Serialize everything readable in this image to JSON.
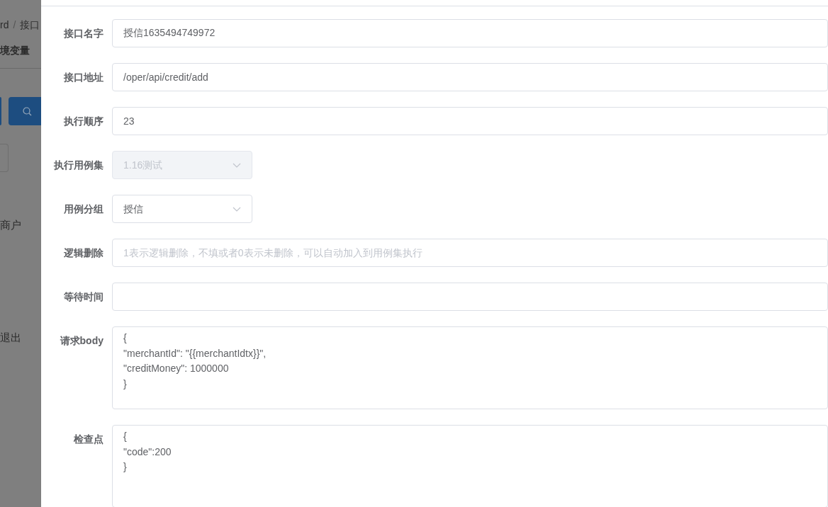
{
  "background": {
    "breadcrumb": [
      "rd",
      "/",
      "接口"
    ],
    "tab": "境变量",
    "menu_items": [
      "商户",
      "退出"
    ]
  },
  "form": {
    "fields": [
      {
        "label": "接口名字",
        "kind": "text",
        "value": "授信1635494749972",
        "disabled": false
      },
      {
        "label": "接口地址",
        "kind": "text",
        "value": "/oper/api/credit/add",
        "disabled": false
      },
      {
        "label": "执行顺序",
        "kind": "text",
        "value": "23",
        "disabled": false
      },
      {
        "label": "执行用例集",
        "kind": "select",
        "value": "1.16测试",
        "disabled": true
      },
      {
        "label": "用例分组",
        "kind": "select",
        "value": "授信",
        "disabled": false
      },
      {
        "label": "逻辑删除",
        "kind": "text",
        "placeholder": "1表示逻辑删除，不填或者0表示未删除，可以自动加入到用例集执行",
        "disabled": false
      },
      {
        "label": "等待时间",
        "kind": "text",
        "disabled": false
      },
      {
        "label": "请求body",
        "kind": "textarea",
        "value": "{\n\"merchantId\": \"{{merchantIdtx}}\",\n\"creditMoney\": 1000000\n}",
        "disabled": false
      },
      {
        "label": "检查点",
        "kind": "textarea",
        "value": "{\n\"code\":200\n}",
        "disabled": false
      }
    ]
  }
}
